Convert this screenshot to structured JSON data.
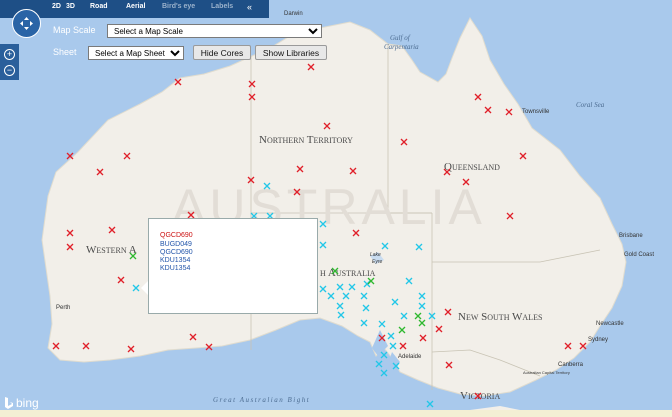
{
  "nav": {
    "tabs": [
      "2D",
      "3D",
      "Road",
      "Aerial",
      "Bird's eye",
      "Labels"
    ],
    "collapse": "«"
  },
  "controls": {
    "map_scale_label": "Map Scale",
    "map_scale_value": "Select a Map Scale",
    "sheet_label": "Sheet",
    "sheet_value": "Select a Map Sheet",
    "hide_cores": "Hide Cores",
    "show_libraries": "Show Libraries"
  },
  "map_labels": {
    "country": "AUSTRALIA",
    "nt": "Northern Territory",
    "qld": "Queensland",
    "wa": "Western A",
    "sa": "h Australia",
    "nsw": "New South Wales",
    "vic": "Victoria",
    "darwin": "Darwin",
    "gulf": "Gulf of",
    "carpentaria": "Carpentaria",
    "coral": "Coral Sea",
    "townsville": "Townsville",
    "brisbane": "Brisbane",
    "goldcoast": "Gold Coast",
    "newcastle": "Newcastle",
    "sydney": "Sydney",
    "canberra": "Canberra",
    "aca": "Australian Capital Territory",
    "adelaide": "Adelaide",
    "perth": "Perth",
    "lake1": "Lake",
    "lake2": "Eyre",
    "bight": "Great Australian Bight"
  },
  "popup": {
    "items": [
      "QGCD690",
      "BUGD049",
      "QGCD690",
      "KDU1354",
      "KDU1354"
    ]
  },
  "branding": "bing",
  "colors": {
    "red": "#e0202a",
    "cyan": "#22c7e8",
    "green": "#2fb830"
  }
}
